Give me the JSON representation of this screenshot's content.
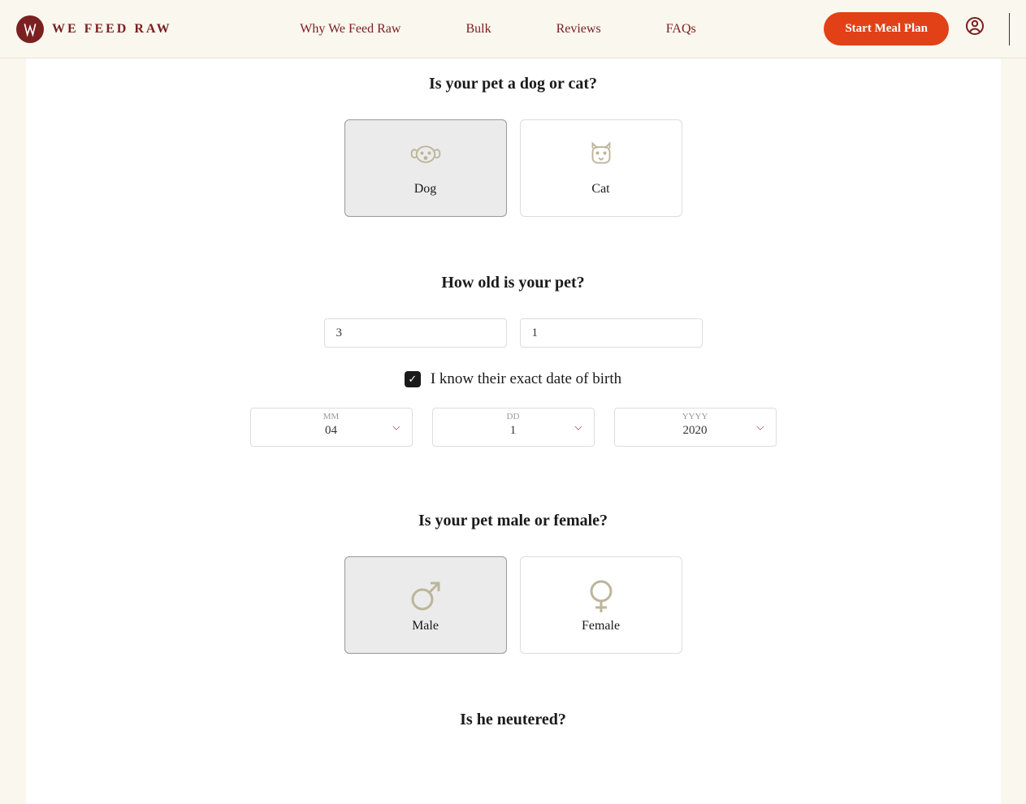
{
  "header": {
    "logo_text": "WE FEED RAW",
    "nav": {
      "why": "Why We Feed Raw",
      "bulk": "Bulk",
      "reviews": "Reviews",
      "faqs": "FAQs"
    },
    "cta": "Start Meal Plan"
  },
  "q1": {
    "title": "Is your pet a dog or cat?",
    "dog": "Dog",
    "cat": "Cat"
  },
  "q2": {
    "title": "How old is your pet?",
    "years": "3",
    "months": "1",
    "know_dob_label": "I know their exact date of birth",
    "mm_label": "MM",
    "mm_value": "04",
    "dd_label": "DD",
    "dd_value": "1",
    "yyyy_label": "YYYY",
    "yyyy_value": "2020"
  },
  "q3": {
    "title": "Is your pet male or female?",
    "male": "Male",
    "female": "Female"
  },
  "q4": {
    "title": "Is he neutered?"
  }
}
